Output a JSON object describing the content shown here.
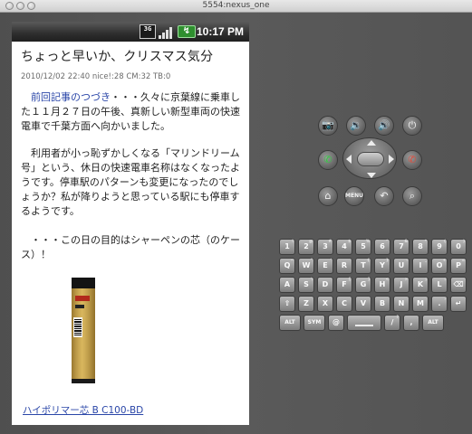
{
  "window": {
    "title": "5554:nexus_one"
  },
  "status_bar": {
    "network": "3G",
    "time": "10:17 PM"
  },
  "post": {
    "title": "ちょっと早いか、クリスマス気分",
    "meta": "2010/12/02 22:40 nice!:28 CM:32 TB:0",
    "para1_link": "前回記事のつづき",
    "para1_rest": "・・・久々に京葉線に乗車した１１月２７日の午後、真新しい新型車両の快速電車で千葉方面へ向かいました。",
    "para2": "利用者が小っ恥ずかしくなる「マリンドリーム号」という、休日の快速電車名称はなくなったようです。停車駅のパターンも変更になったのでしょうか？私が降りようと思っている駅にも停車するようです。",
    "para3": "・・・この日の目的はシャーペンの芯（のケース）！",
    "product_link": "ハイポリマー芯 B C100-BD"
  },
  "controls": {
    "buttons": {
      "camera": "📷",
      "volume_down": "🔉",
      "volume_up": "🔊",
      "power": "⏻",
      "call": "✆",
      "end_call": "✆",
      "home": "⌂",
      "menu": "MENU",
      "back": "↶",
      "search": "⌕"
    }
  },
  "keyboard": {
    "rows": [
      [
        {
          "k": "1",
          "a": "!"
        },
        {
          "k": "2",
          "a": "@"
        },
        {
          "k": "3",
          "a": "#"
        },
        {
          "k": "4",
          "a": "$"
        },
        {
          "k": "5",
          "a": "%"
        },
        {
          "k": "6",
          "a": "^"
        },
        {
          "k": "7",
          "a": "&"
        },
        {
          "k": "8",
          "a": "*"
        },
        {
          "k": "9",
          "a": "("
        },
        {
          "k": "0",
          "a": ")"
        }
      ],
      [
        {
          "k": "Q",
          "a": "~"
        },
        {
          "k": "W",
          "a": "\""
        },
        {
          "k": "E",
          "a": "'"
        },
        {
          "k": "R",
          "a": ""
        },
        {
          "k": "T",
          "a": "{"
        },
        {
          "k": "Y",
          "a": "}"
        },
        {
          "k": "U",
          "a": "-"
        },
        {
          "k": "I",
          "a": "_"
        },
        {
          "k": "O",
          "a": "+"
        },
        {
          "k": "P",
          "a": "="
        }
      ],
      [
        {
          "k": "A",
          "a": ""
        },
        {
          "k": "S",
          "a": "\\"
        },
        {
          "k": "D",
          "a": ""
        },
        {
          "k": "F",
          "a": "["
        },
        {
          "k": "G",
          "a": "]"
        },
        {
          "k": "H",
          "a": "<"
        },
        {
          "k": "J",
          "a": ">"
        },
        {
          "k": "K",
          "a": ";"
        },
        {
          "k": "L",
          "a": ":"
        },
        {
          "k": "⌫",
          "a": ""
        }
      ],
      [
        {
          "k": "⇧",
          "a": ""
        },
        {
          "k": "Z",
          "a": ""
        },
        {
          "k": "X",
          "a": ""
        },
        {
          "k": "C",
          "a": ""
        },
        {
          "k": "V",
          "a": ""
        },
        {
          "k": "B",
          "a": ""
        },
        {
          "k": "N",
          "a": ""
        },
        {
          "k": "M",
          "a": ""
        },
        {
          "k": ".",
          "a": ","
        },
        {
          "k": "↵",
          "a": ""
        }
      ],
      [
        {
          "k": "ALT",
          "a": ""
        },
        {
          "k": "SYM",
          "a": ""
        },
        {
          "k": "@",
          "a": ""
        },
        {
          "k": "SPACE",
          "a": ""
        },
        {
          "k": "/",
          "a": "?"
        },
        {
          "k": ",",
          "a": ""
        },
        {
          "k": "ALT",
          "a": ""
        }
      ]
    ]
  }
}
